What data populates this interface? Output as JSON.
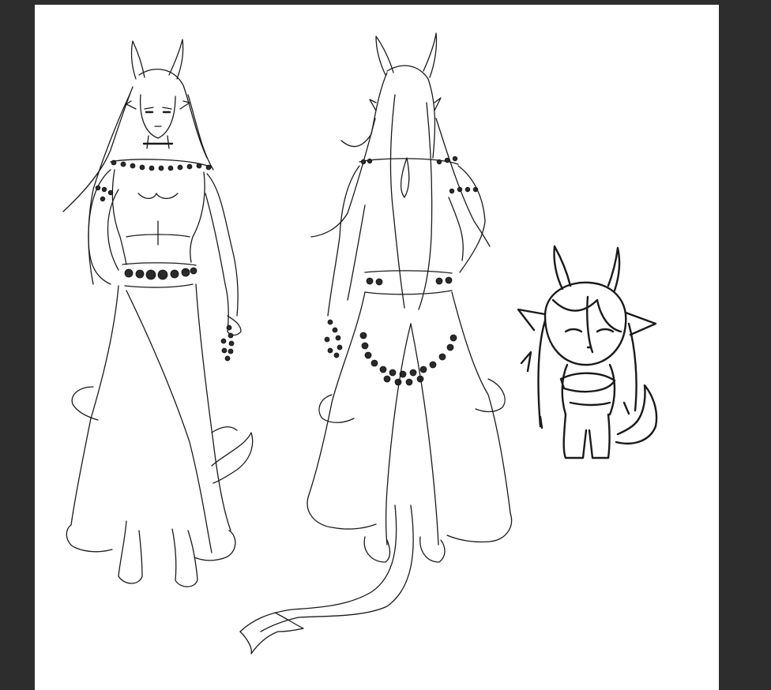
{
  "canvas": {
    "background_color": "#2d2d2d",
    "paper_color": "#ffffff",
    "ink_color": "#1a1a1a"
  },
  "artwork": {
    "subject": "character-reference-sheet",
    "figures": [
      {
        "view": "front",
        "icon": "figure-front"
      },
      {
        "view": "back",
        "icon": "figure-back"
      },
      {
        "view": "chibi",
        "icon": "figure-chibi"
      }
    ]
  }
}
